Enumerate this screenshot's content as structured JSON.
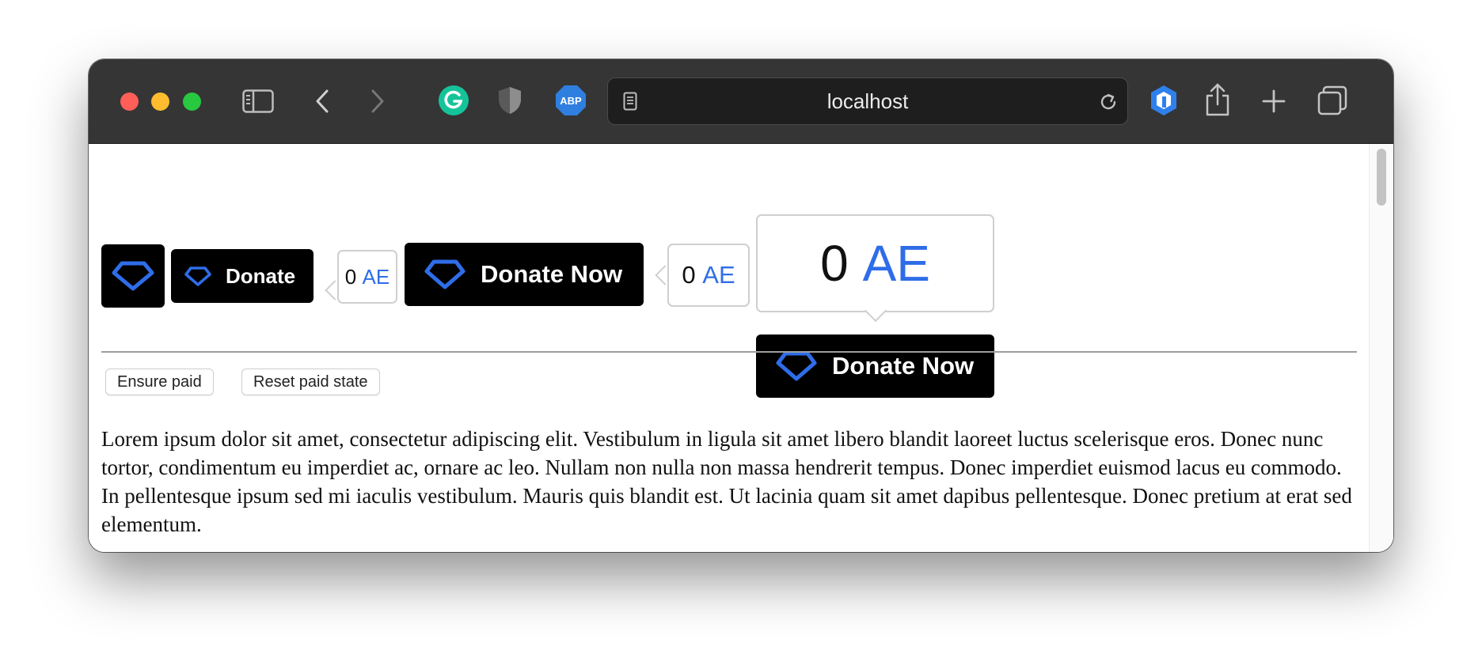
{
  "browser": {
    "address": "localhost",
    "toolbar_icons": [
      "sidebar-icon",
      "back-icon",
      "forward-icon",
      "grammarly-extension-icon",
      "privacy-shield-icon",
      "adblock-plus-icon",
      "reader-icon",
      "reload-icon",
      "hex-extension-icon",
      "share-icon",
      "new-tab-icon",
      "tab-overview-icon"
    ],
    "extensions": {
      "abp_label": "ABP"
    }
  },
  "widgets": {
    "donate_label": "Donate",
    "donate_now_label": "Donate Now",
    "amount": "0",
    "currency": "AE"
  },
  "controls": {
    "ensure_paid": "Ensure paid",
    "reset_paid": "Reset paid state"
  },
  "body_text": "Lorem ipsum dolor sit amet, consectetur adipiscing elit. Vestibulum in ligula sit amet libero blandit laoreet luctus scelerisque eros. Donec nunc tortor, condimentum eu imperdiet ac, ornare ac leo. Nullam non nulla non massa hendrerit tempus. Donec imperdiet euismod lacus eu commodo. In pellentesque ipsum sed mi iaculis vestibulum. Mauris quis blandit est. Ut lacinia quam sit amet dapibus pellentesque. Donec pretium at erat sed elementum.",
  "colors": {
    "accent_blue": "#2f6de8",
    "button_black": "#000000",
    "toolbar": "#353535"
  }
}
